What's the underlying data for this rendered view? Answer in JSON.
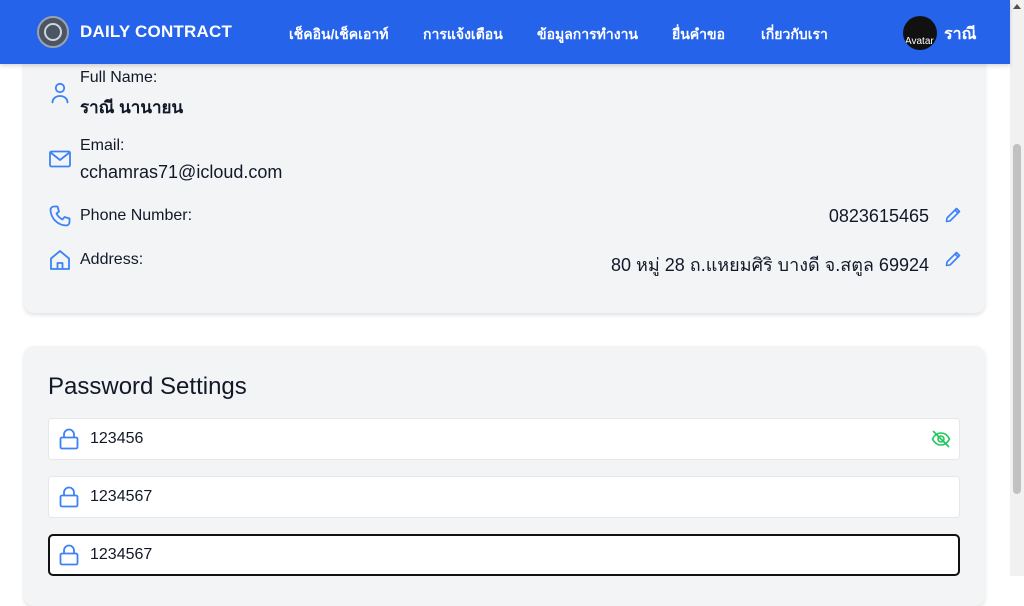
{
  "navbar": {
    "brand": "DAILY CONTRACT",
    "items": [
      {
        "label": "เช็คอิน/เช็คเอาท์"
      },
      {
        "label": "การแจ้งเตือน"
      },
      {
        "label": "ข้อมูลการทำงาน"
      },
      {
        "label": "ยื่นคำขอ"
      },
      {
        "label": "เกี่ยวกับเรา"
      }
    ],
    "avatar_alt": "Avatar",
    "user_name": "ราณี"
  },
  "profile": {
    "full_name_label": "Full Name:",
    "full_name": "ราณี นานายน",
    "email_label": "Email:",
    "email": "cchamras71@icloud.com",
    "phone_label": "Phone Number:",
    "phone": "0823615465",
    "address_label": "Address:",
    "address": "80 หมู่ 28 ถ.แหยมศิริ บางดี จ.สตูล 69924"
  },
  "password_settings": {
    "title": "Password Settings",
    "fields": [
      {
        "value": "123456"
      },
      {
        "value": "1234567"
      },
      {
        "value": "1234567"
      }
    ]
  },
  "colors": {
    "navbar": "#2563eb",
    "icon_blue": "#3b82f6",
    "eye_green": "#22c55e",
    "card_bg": "#f3f4f6"
  }
}
